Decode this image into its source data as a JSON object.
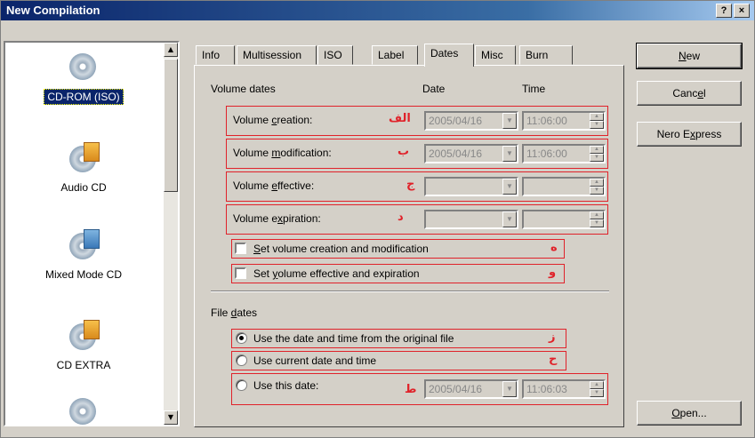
{
  "window": {
    "title": "New Compilation",
    "help_label": "?",
    "close_label": "×"
  },
  "sidebar": {
    "items": [
      {
        "label": "CD-ROM (ISO)",
        "icon": "cd-rom-iso-icon",
        "selected": true
      },
      {
        "label": "Audio CD",
        "icon": "audio-cd-icon"
      },
      {
        "label": "Mixed Mode CD",
        "icon": "mixed-mode-cd-icon"
      },
      {
        "label": "CD EXTRA",
        "icon": "cd-extra-icon"
      }
    ]
  },
  "tabs": [
    "Info",
    "Multisession",
    "ISO",
    "Label",
    "Dates",
    "Misc",
    "Burn"
  ],
  "active_tab": "Dates",
  "volume_dates": {
    "heading": "Volume dates",
    "col_date": "Date",
    "col_time": "Time",
    "rows": [
      {
        "label_pre": "Volume ",
        "label_u": "c",
        "label_post": "reation:",
        "marker": "الف",
        "date": "2005/04/16",
        "time": "11:06:00"
      },
      {
        "label_pre": "Volume ",
        "label_u": "m",
        "label_post": "odification:",
        "marker": "ب",
        "date": "2005/04/16",
        "time": "11:06:00"
      },
      {
        "label_pre": "Volume ",
        "label_u": "e",
        "label_post": "ffective:",
        "marker": "ج",
        "date": "",
        "time": ""
      },
      {
        "label_pre": "Volume e",
        "label_u": "x",
        "label_post": "piration:",
        "marker": "د",
        "date": "",
        "time": ""
      }
    ],
    "checkboxes": [
      {
        "label_pre": "",
        "label_u": "S",
        "label_post": "et volume creation and modification",
        "marker": "ه",
        "checked": false
      },
      {
        "label_pre": "Set ",
        "label_u": "y",
        "label_post": "olume effective and expiration",
        "marker": "و",
        "checked": false
      }
    ]
  },
  "file_dates": {
    "heading_pre": "File ",
    "heading_u": "d",
    "heading_post": "ates",
    "options": [
      {
        "label": "Use the date and time from the original file",
        "marker": "ز",
        "selected": true
      },
      {
        "label": "Use current date and time",
        "marker": "ح",
        "selected": false
      },
      {
        "label": "Use this date:",
        "marker": "ط",
        "selected": false,
        "date": "2005/04/16",
        "time": "11:06:03"
      }
    ]
  },
  "buttons": {
    "new_pre": "",
    "new_u": "N",
    "new_post": "ew",
    "cancel_pre": "Canc",
    "cancel_u": "e",
    "cancel_post": "l",
    "nero_pre": "Nero E",
    "nero_u": "x",
    "nero_post": "press",
    "open_pre": "",
    "open_u": "O",
    "open_post": "pen..."
  },
  "colors": {
    "title_bar": "#0a246a",
    "annotation_red": "#e0222a",
    "face": "#d4d0c8"
  }
}
